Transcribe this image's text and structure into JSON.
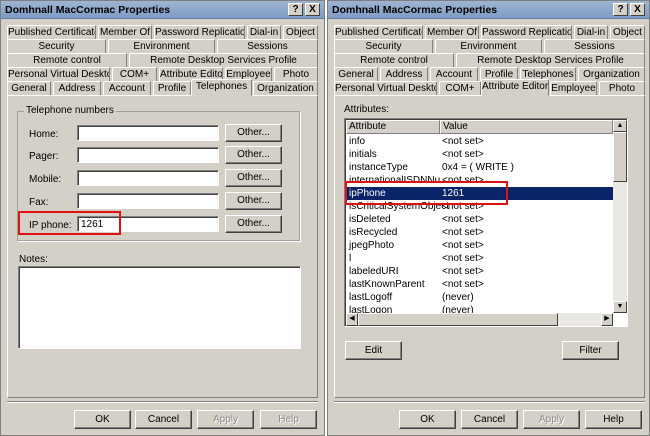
{
  "left": {
    "title": "Domhnall MacCormac Properties",
    "help_glyph": "?",
    "close_glyph": "X",
    "tabs_row1": [
      "Published Certificates",
      "Member Of",
      "Password Replication",
      "Dial-in",
      "Object"
    ],
    "tabs_row2": [
      "Security",
      "Environment",
      "Sessions"
    ],
    "tabs_row3": [
      "Remote control",
      "Remote Desktop Services Profile"
    ],
    "tabs_row4": [
      "Personal Virtual Desktop",
      "COM+",
      "Attribute Editor",
      "Employee",
      "Photo"
    ],
    "tabs_row5": [
      "General",
      "Address",
      "Account",
      "Profile",
      "Telephones",
      "Organization"
    ],
    "group_label": "Telephone numbers",
    "phones": [
      {
        "label": "Home:",
        "value": "",
        "other": "Other..."
      },
      {
        "label": "Pager:",
        "value": "",
        "other": "Other..."
      },
      {
        "label": "Mobile:",
        "value": "",
        "other": "Other..."
      },
      {
        "label": "Fax:",
        "value": "",
        "other": "Other..."
      },
      {
        "label": "IP phone:",
        "value": "1261",
        "other": "Other..."
      }
    ],
    "notes_label": "Notes:",
    "notes_value": "",
    "buttons": {
      "ok": "OK",
      "cancel": "Cancel",
      "apply": "Apply",
      "help": "Help"
    }
  },
  "right": {
    "title": "Domhnall MacCormac Properties",
    "help_glyph": "?",
    "close_glyph": "X",
    "tabs_row1": [
      "Published Certificates",
      "Member Of",
      "Password Replication",
      "Dial-in",
      "Object"
    ],
    "tabs_row2": [
      "Security",
      "Environment",
      "Sessions"
    ],
    "tabs_row3": [
      "Remote control",
      "Remote Desktop Services Profile"
    ],
    "tabs_row4": [
      "General",
      "Address",
      "Account",
      "Profile",
      "Telephones",
      "Organization"
    ],
    "tabs_row5": [
      "Personal Virtual Desktop",
      "COM+",
      "Attribute Editor",
      "Employee",
      "Photo"
    ],
    "attributes_label": "Attributes:",
    "columns": {
      "attribute": "Attribute",
      "value": "Value"
    },
    "rows": [
      {
        "a": "info",
        "v": "<not set>"
      },
      {
        "a": "initials",
        "v": "<not set>"
      },
      {
        "a": "instanceType",
        "v": "0x4 = ( WRITE )"
      },
      {
        "a": "internationalISDNNu...",
        "v": "<not set>"
      },
      {
        "a": "ipPhone",
        "v": "1261"
      },
      {
        "a": "isCriticalSystemObject",
        "v": "<not set>"
      },
      {
        "a": "isDeleted",
        "v": "<not set>"
      },
      {
        "a": "isRecycled",
        "v": "<not set>"
      },
      {
        "a": "jpegPhoto",
        "v": "<not set>"
      },
      {
        "a": "l",
        "v": "<not set>"
      },
      {
        "a": "labeledURI",
        "v": "<not set>"
      },
      {
        "a": "lastKnownParent",
        "v": "<not set>"
      },
      {
        "a": "lastLogoff",
        "v": "(never)"
      },
      {
        "a": "lastLogon",
        "v": "(never)"
      }
    ],
    "selected_index": 4,
    "edit_label": "Edit",
    "filter_label": "Filter",
    "buttons": {
      "ok": "OK",
      "cancel": "Cancel",
      "apply": "Apply",
      "help": "Help"
    }
  },
  "colors": {
    "highlight_box": "#e01010",
    "selection": "#0a246a"
  }
}
